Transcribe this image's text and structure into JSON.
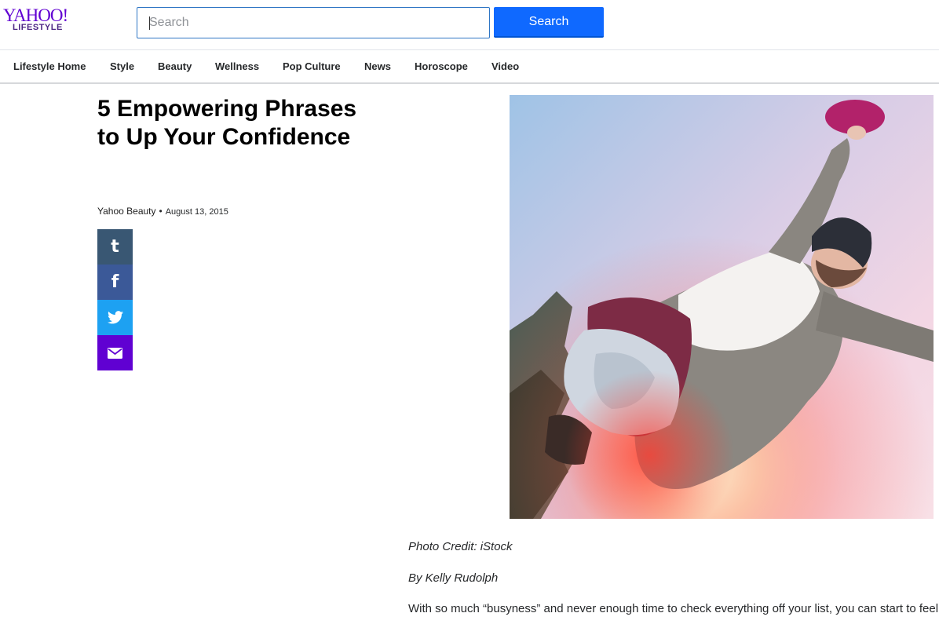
{
  "brand": {
    "logo_text": "YAHOO!",
    "logo_subtext": "LIFESTYLE"
  },
  "search": {
    "placeholder": "Search",
    "value": "",
    "button_label": "Search"
  },
  "nav": {
    "items": [
      {
        "label": "Lifestyle Home"
      },
      {
        "label": "Style"
      },
      {
        "label": "Beauty"
      },
      {
        "label": "Wellness"
      },
      {
        "label": "Pop Culture"
      },
      {
        "label": "News"
      },
      {
        "label": "Horoscope"
      },
      {
        "label": "Video"
      }
    ]
  },
  "article": {
    "title": "5 Empowering Phrases to Up Your Confidence",
    "source": "Yahoo Beauty",
    "separator": "•",
    "date": "August 13, 2015",
    "photo_credit": "Photo Credit: iStock",
    "author_line": "By Kelly Rudolph",
    "paragraph": "With so much “busyness” and never enough time to check everything off your list, you can start to feel"
  },
  "share": {
    "tumblr_glyph": "t",
    "facebook_glyph": "f",
    "buttons": [
      "tumblr-icon",
      "facebook-icon",
      "twitter-icon",
      "mail-icon"
    ]
  },
  "colors": {
    "brand_purple": "#6001d2",
    "search_button": "#0f69ff",
    "tumblr": "#395773",
    "facebook": "#3b5998",
    "twitter": "#1da1f2",
    "mail": "#6001d2"
  }
}
